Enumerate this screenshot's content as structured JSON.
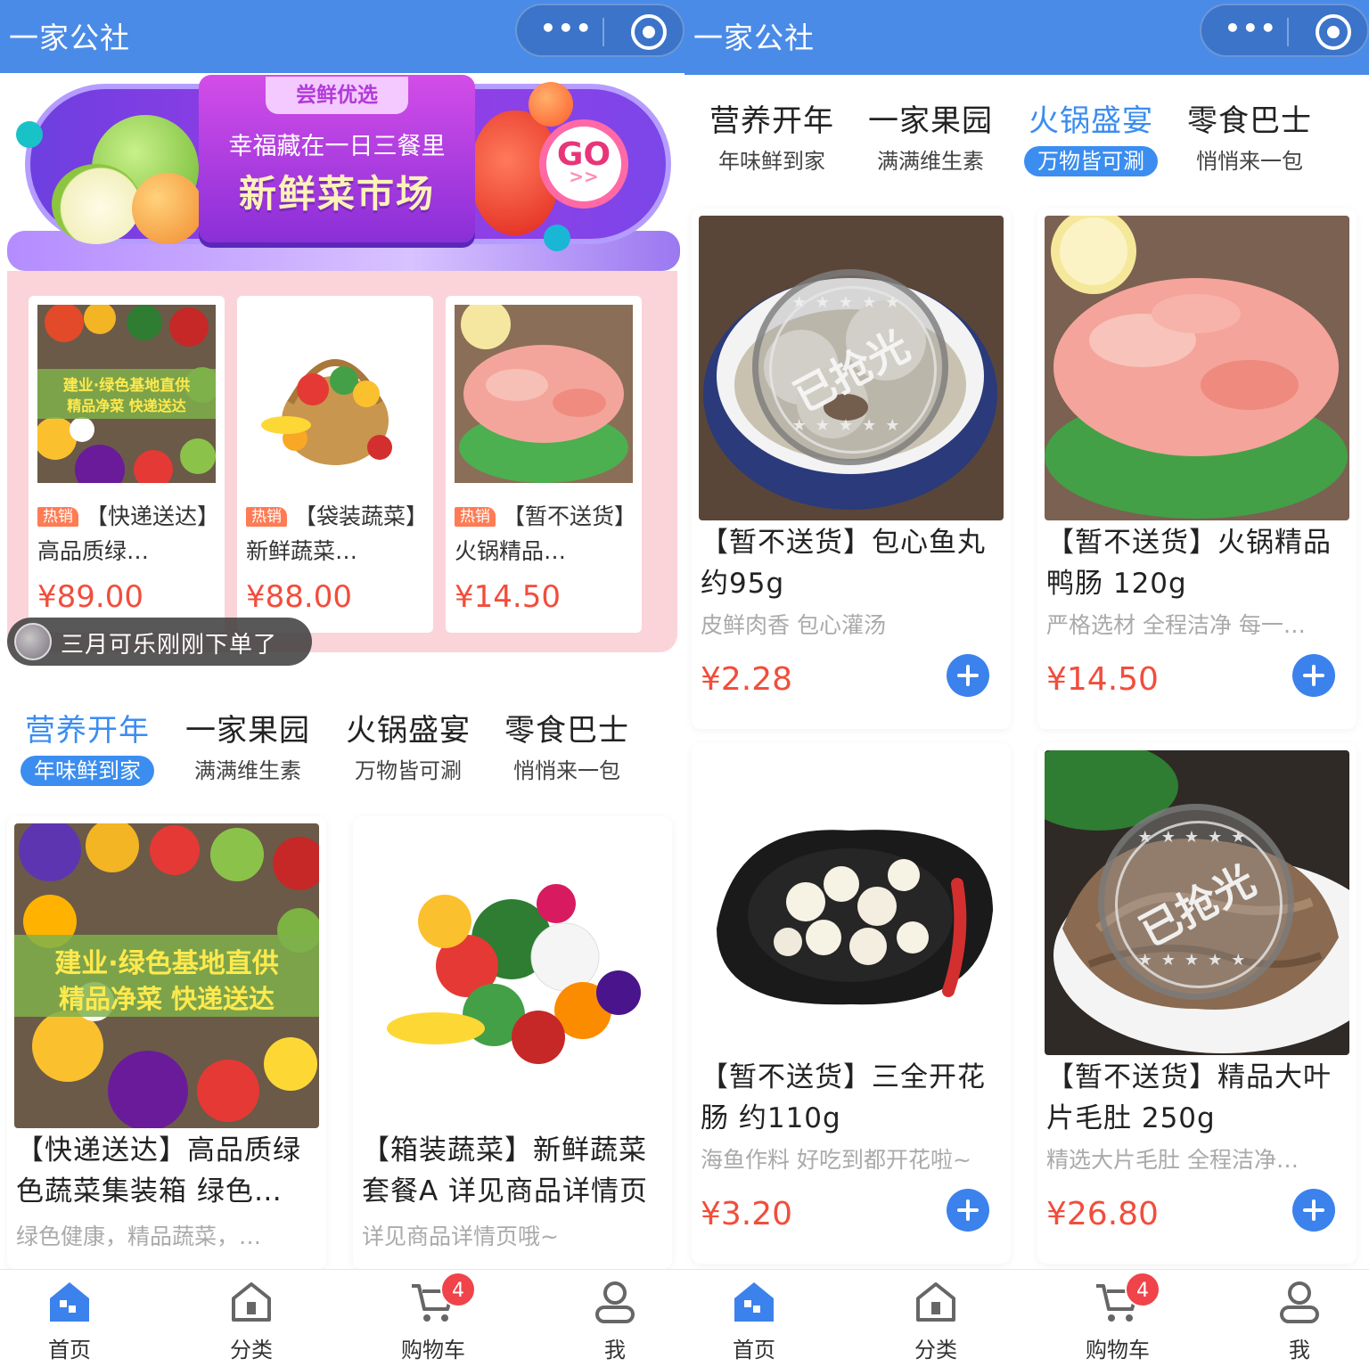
{
  "app": {
    "title": "一家公社",
    "menu_glyph": "•••"
  },
  "colors": {
    "nav": "#4a8be8",
    "accent": "#3b8df0",
    "price": "#f24d3c",
    "hot_bg": "#fbd4d9"
  },
  "left": {
    "banner": {
      "tag": "尝鲜优选",
      "subtitle": "幸福藏在一日三餐里",
      "main": "新鲜菜市场",
      "go": "GO",
      "go_arrows": ">>"
    },
    "hot": [
      {
        "badge": "热销",
        "name": "【快递送达】高品质绿…",
        "price": "¥89.00",
        "img_text_1": "建业·绿色基地直供",
        "img_text_2": "精品净菜  快递送达"
      },
      {
        "badge": "热销",
        "name": "【袋装蔬菜】新鲜蔬菜…",
        "price": "¥88.00"
      },
      {
        "badge": "热销",
        "name": "【暂不送货】火锅精品…",
        "price": "¥14.50"
      }
    ],
    "ticker": "三月可乐刚刚下单了",
    "tabs": [
      {
        "title": "营养开年",
        "sub": "年味鲜到家"
      },
      {
        "title": "一家果园",
        "sub": "满满维生素"
      },
      {
        "title": "火锅盛宴",
        "sub": "万物皆可涮"
      },
      {
        "title": "零食巴士",
        "sub": "悄悄来一包"
      }
    ],
    "products": [
      {
        "name": "【快递送达】高品质绿色蔬菜集装箱 绿色…",
        "desc": "绿色健康，精品蔬菜，…",
        "img_text_1": "建业·绿色基地直供",
        "img_text_2": "精品净菜  快递送达"
      },
      {
        "name": "【箱装蔬菜】新鲜蔬菜套餐A 详见商品详情页",
        "desc": "详见商品详情页哦~"
      }
    ]
  },
  "right": {
    "tabs": [
      {
        "title": "营养开年",
        "sub": "年味鲜到家"
      },
      {
        "title": "一家果园",
        "sub": "满满维生素"
      },
      {
        "title": "火锅盛宴",
        "sub": "万物皆可涮"
      },
      {
        "title": "零食巴士",
        "sub": "悄悄来一包"
      }
    ],
    "products": [
      {
        "name": "【暂不送货】包心鱼丸 约95g",
        "desc": "皮鲜肉香 包心灌汤",
        "price": "¥2.28",
        "sold_out": "已抢光"
      },
      {
        "name": "【暂不送货】火锅精品鸭肠 120g",
        "desc": "严格选材 全程洁净 每一…",
        "price": "¥14.50"
      },
      {
        "name": "【暂不送货】三全开花肠 约110g",
        "desc": "海鱼作料 好吃到都开花啦~",
        "price": "¥3.20"
      },
      {
        "name": "【暂不送货】精品大叶片毛肚 250g",
        "desc": "精选大片毛肚 全程洁净…",
        "price": "¥26.80",
        "sold_out": "已抢光"
      }
    ]
  },
  "tabbar": {
    "items": [
      {
        "label": "首页",
        "icon": "home-icon"
      },
      {
        "label": "分类",
        "icon": "category-icon"
      },
      {
        "label": "购物车",
        "icon": "cart-icon",
        "badge": "4"
      },
      {
        "label": "我",
        "icon": "profile-icon"
      }
    ]
  }
}
